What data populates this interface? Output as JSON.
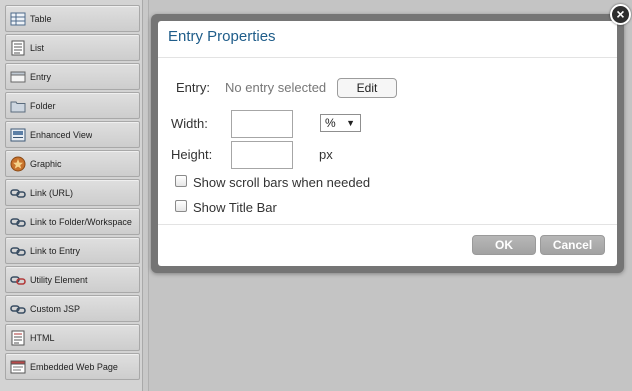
{
  "palette": {
    "items": [
      {
        "label": "Table",
        "icon": "table-icon"
      },
      {
        "label": "List",
        "icon": "list-icon"
      },
      {
        "label": "Entry",
        "icon": "entry-icon"
      },
      {
        "label": "Folder",
        "icon": "folder-icon"
      },
      {
        "label": "Enhanced View",
        "icon": "enhanced-view-icon"
      },
      {
        "label": "Graphic",
        "icon": "graphic-icon"
      },
      {
        "label": "Link (URL)",
        "icon": "link-icon"
      },
      {
        "label": "Link to Folder/Workspace",
        "icon": "link-icon"
      },
      {
        "label": "Link to Entry",
        "icon": "link-icon"
      },
      {
        "label": "Utility Element",
        "icon": "link-icon"
      },
      {
        "label": "Custom JSP",
        "icon": "link-icon"
      },
      {
        "label": "HTML",
        "icon": "html-icon"
      },
      {
        "label": "Embedded Web Page",
        "icon": "web-page-icon"
      }
    ]
  },
  "dialog": {
    "title": "Entry Properties",
    "entry_label": "Entry:",
    "entry_value": "No entry selected",
    "edit_label": "Edit",
    "width_label": "Width:",
    "width_value": "",
    "width_unit": "%",
    "height_label": "Height:",
    "height_value": "",
    "height_unit": "px",
    "scrollbars_label": "Show scroll bars when needed",
    "scrollbars_checked": false,
    "titlebar_label": "Show Title Bar",
    "titlebar_checked": false,
    "ok_label": "OK",
    "cancel_label": "Cancel"
  },
  "colors": {
    "title": "#1f5d8a",
    "footer_button": "#a9a9a9"
  }
}
